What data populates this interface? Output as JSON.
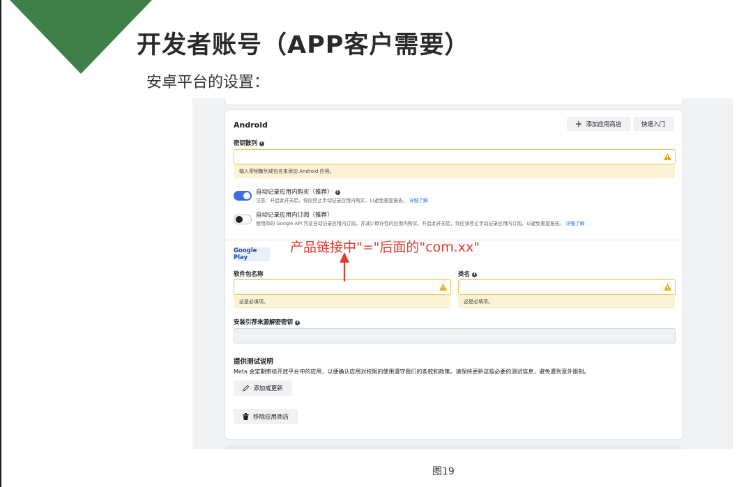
{
  "slide": {
    "title": "开发者账号（APP客户需要）",
    "subtitle": "安卓平台的设置：",
    "caption": "图19",
    "annotation": "产品链接中\"=\"后面的\"com.xx\"",
    "colors": {
      "accent_triangle": "#3f8048",
      "annotation": "#e03a2e"
    }
  },
  "android_panel": {
    "title": "Android",
    "add_store_button": "添加应用商店",
    "quick_start_button": "快速入门",
    "key_hash": {
      "label": "密钥散列",
      "value": "",
      "warning": "输入密钥散列或包名来添加 Android 应用。"
    },
    "auto_log_purchases": {
      "label": "自动记录应用内购买（推荐）",
      "desc": "注意：开启此开关后，你应停止手动记录应用内购买，以避免重复报告。",
      "link": "详细了解",
      "enabled": true
    },
    "auto_log_subscriptions": {
      "label": "自动记录应用内订阅（推荐）",
      "desc": "使用你的 Google API 凭证自动记录应用内订阅，并减少欺诈性的应用内购买。开启此开关后，你应该停止手动记录应用内订阅，以避免重复报告。",
      "link": "详细了解",
      "enabled": false
    }
  },
  "google_play": {
    "tag": "Google Play",
    "package_name": {
      "label": "软件包名称",
      "value": "",
      "warning": "这是必填项。"
    },
    "class_name": {
      "label": "类名",
      "value": "",
      "warning": "这是必填项。"
    },
    "install_referrer": {
      "label": "安装引荐来源解密密钥",
      "value": ""
    }
  },
  "testing": {
    "title": "提供测试说明",
    "desc": "Meta 会定期审核开放平台中的应用，以便确认应用对权限的使用遵守我们的条款和政策。请保持更新这些必要的测试信息，避免遭到意外限制。",
    "add_update_button": "添加或更新",
    "remove_store_button": "移除应用商店"
  },
  "icons": {
    "info": "info-icon",
    "warning": "warning-icon",
    "plus": "plus-icon",
    "pencil": "pencil-icon",
    "trash": "trash-icon"
  }
}
